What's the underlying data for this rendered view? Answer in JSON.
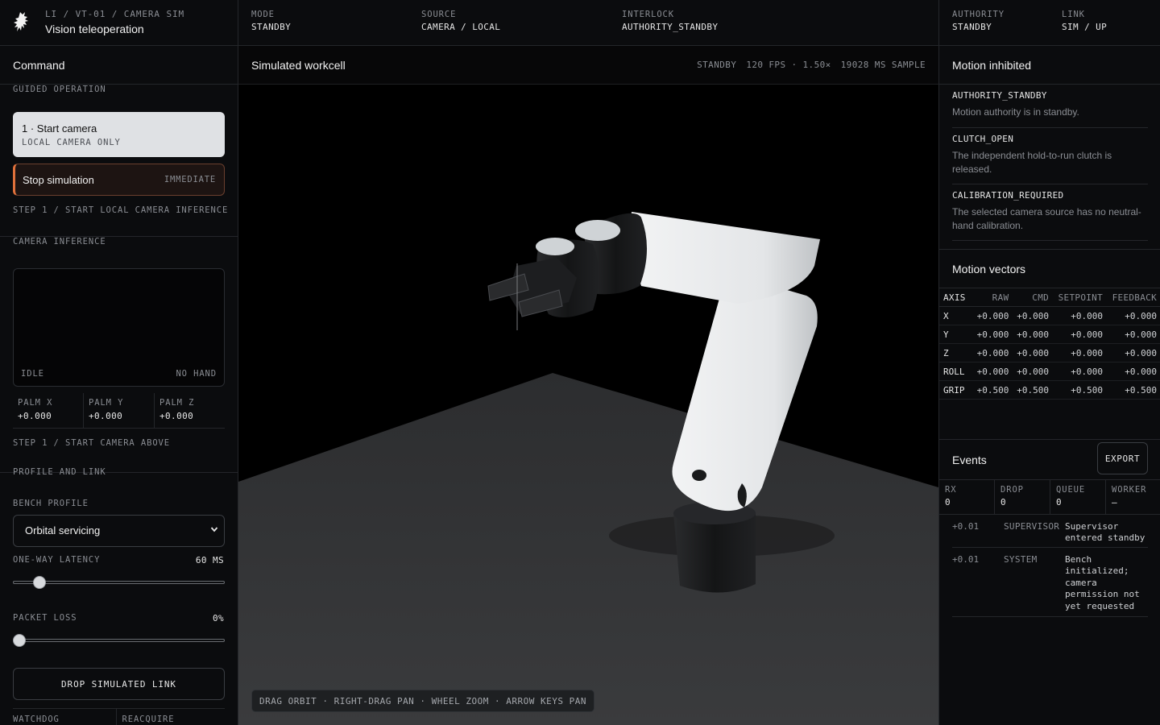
{
  "topbar": {
    "crumb": "LI / VT-01 / CAMERA SIM",
    "title": "Vision teleoperation",
    "fields": [
      {
        "label": "MODE",
        "value": "STANDBY"
      },
      {
        "label": "SOURCE",
        "value": "CAMERA / LOCAL"
      },
      {
        "label": "INTERLOCK",
        "value": "AUTHORITY_STANDBY"
      }
    ],
    "right_fields": [
      {
        "label": "AUTHORITY",
        "value": "STANDBY"
      },
      {
        "label": "LINK",
        "value": "SIM / UP"
      }
    ]
  },
  "left": {
    "title": "Command",
    "guided_label": "GUIDED OPERATION",
    "start_button": {
      "title": "1 · Start camera",
      "subtitle": "LOCAL CAMERA ONLY"
    },
    "stop_button": {
      "title": "Stop simulation",
      "badge": "IMMEDIATE"
    },
    "step_hint": "STEP 1 / START LOCAL CAMERA INFERENCE",
    "camera_label": "CAMERA INFERENCE",
    "camera_state": "IDLE",
    "camera_hand": "NO HAND",
    "palm": [
      {
        "label": "PALM X",
        "value": "+0.000"
      },
      {
        "label": "PALM Y",
        "value": "+0.000"
      },
      {
        "label": "PALM Z",
        "value": "+0.000"
      }
    ],
    "camera_hint": "STEP 1 / START CAMERA ABOVE",
    "profile_label": "PROFILE AND LINK",
    "bench_label": "BENCH PROFILE",
    "bench_value": "Orbital servicing",
    "latency_label": "ONE-WAY LATENCY",
    "latency_value": "60 MS",
    "latency_fraction": 0.1,
    "loss_label": "PACKET LOSS",
    "loss_value": "0%",
    "loss_fraction": 0.0,
    "drop_button": "DROP SIMULATED LINK",
    "watchdog_label": "WATCHDOG",
    "reacquire_label": "REACQUIRE"
  },
  "center": {
    "title": "Simulated workcell",
    "stats": [
      "STANDBY",
      "120 FPS · 1.50×",
      "19028 MS SAMPLE"
    ],
    "hint": "DRAG ORBIT · RIGHT-DRAG PAN · WHEEL ZOOM · ARROW KEYS PAN"
  },
  "right": {
    "inhibit_title": "Motion inhibited",
    "inhibits": [
      {
        "code": "AUTHORITY_STANDBY",
        "desc": "Motion authority is in standby."
      },
      {
        "code": "CLUTCH_OPEN",
        "desc": "The independent hold-to-run clutch is released."
      },
      {
        "code": "CALIBRATION_REQUIRED",
        "desc": "The selected camera source has no neutral-hand calibration."
      }
    ],
    "vectors_title": "Motion vectors",
    "vector_headers": [
      "AXIS",
      "RAW",
      "CMD",
      "SETPOINT",
      "FEEDBACK"
    ],
    "vectors": [
      [
        "X",
        "+0.000",
        "+0.000",
        "+0.000",
        "+0.000"
      ],
      [
        "Y",
        "+0.000",
        "+0.000",
        "+0.000",
        "+0.000"
      ],
      [
        "Z",
        "+0.000",
        "+0.000",
        "+0.000",
        "+0.000"
      ],
      [
        "ROLL",
        "+0.000",
        "+0.000",
        "+0.000",
        "+0.000"
      ],
      [
        "GRIP",
        "+0.500",
        "+0.500",
        "+0.500",
        "+0.500"
      ]
    ],
    "events_title": "Events",
    "export_button": "EXPORT",
    "counters": [
      {
        "label": "RX",
        "value": "0"
      },
      {
        "label": "DROP",
        "value": "0"
      },
      {
        "label": "QUEUE",
        "value": "0"
      },
      {
        "label": "WORKER",
        "value": "—"
      }
    ],
    "events": [
      {
        "time": "+0.01",
        "source": "SUPERVISOR",
        "message": "Supervisor entered standby"
      },
      {
        "time": "+0.01",
        "source": "SYSTEM",
        "message": "Bench initialized; camera permission not yet requested"
      }
    ]
  },
  "colors": {
    "accent_stop": "#e0713b",
    "background": "#0b0c0e",
    "primary_button": "#dfe1e4"
  }
}
